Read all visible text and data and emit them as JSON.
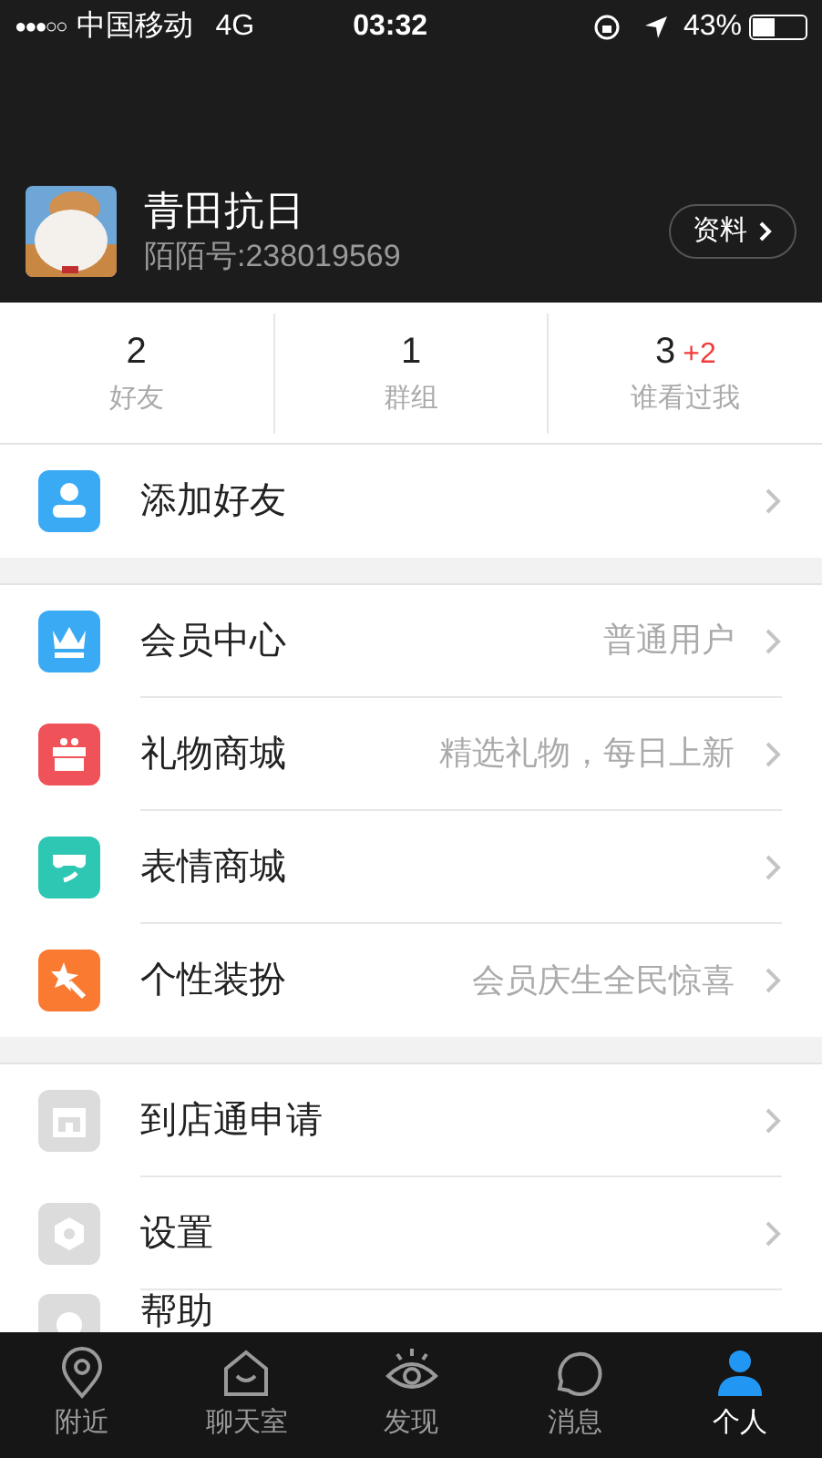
{
  "status_bar": {
    "signal": "●●●○○",
    "carrier": "中国移动",
    "network": "4G",
    "time": "03:32",
    "battery": "43%"
  },
  "profile": {
    "name": "青田抗日",
    "id_text": "陌陌号:238019569",
    "button": "资料"
  },
  "stats": [
    {
      "count": "2",
      "label": "好友"
    },
    {
      "count": "1",
      "label": "群组"
    },
    {
      "count": "3",
      "badge": "+2",
      "label": "谁看过我"
    }
  ],
  "sections": [
    [
      {
        "kind": "person",
        "color": "#3baaf5",
        "label": "添加好友"
      }
    ],
    [
      {
        "kind": "crown",
        "color": "#3baaf5",
        "label": "会员中心",
        "detail": "普通用户"
      },
      {
        "kind": "gift",
        "color": "#f0525a",
        "label": "礼物商城",
        "detail": "精选礼物，每日上新"
      },
      {
        "kind": "face",
        "color": "#2ec7b4",
        "label": "表情商城"
      },
      {
        "kind": "wand",
        "color": "#fa7a32",
        "label": "个性装扮",
        "detail": "会员庆生全民惊喜"
      }
    ],
    [
      {
        "kind": "store",
        "color": "#dcdcdc",
        "label": "到店通申请"
      },
      {
        "kind": "gear",
        "color": "#dcdcdc",
        "label": "设置"
      },
      {
        "kind": "help",
        "color": "#dcdcdc",
        "label": "帮助"
      }
    ]
  ],
  "tab_bar": [
    {
      "kind": "pin",
      "label": "附近",
      "selected": false
    },
    {
      "kind": "house",
      "label": "聊天室",
      "selected": false
    },
    {
      "kind": "eye",
      "label": "发现",
      "selected": false
    },
    {
      "kind": "bubble",
      "label": "消息",
      "selected": false
    },
    {
      "kind": "person",
      "label": "个人",
      "selected": true
    }
  ]
}
